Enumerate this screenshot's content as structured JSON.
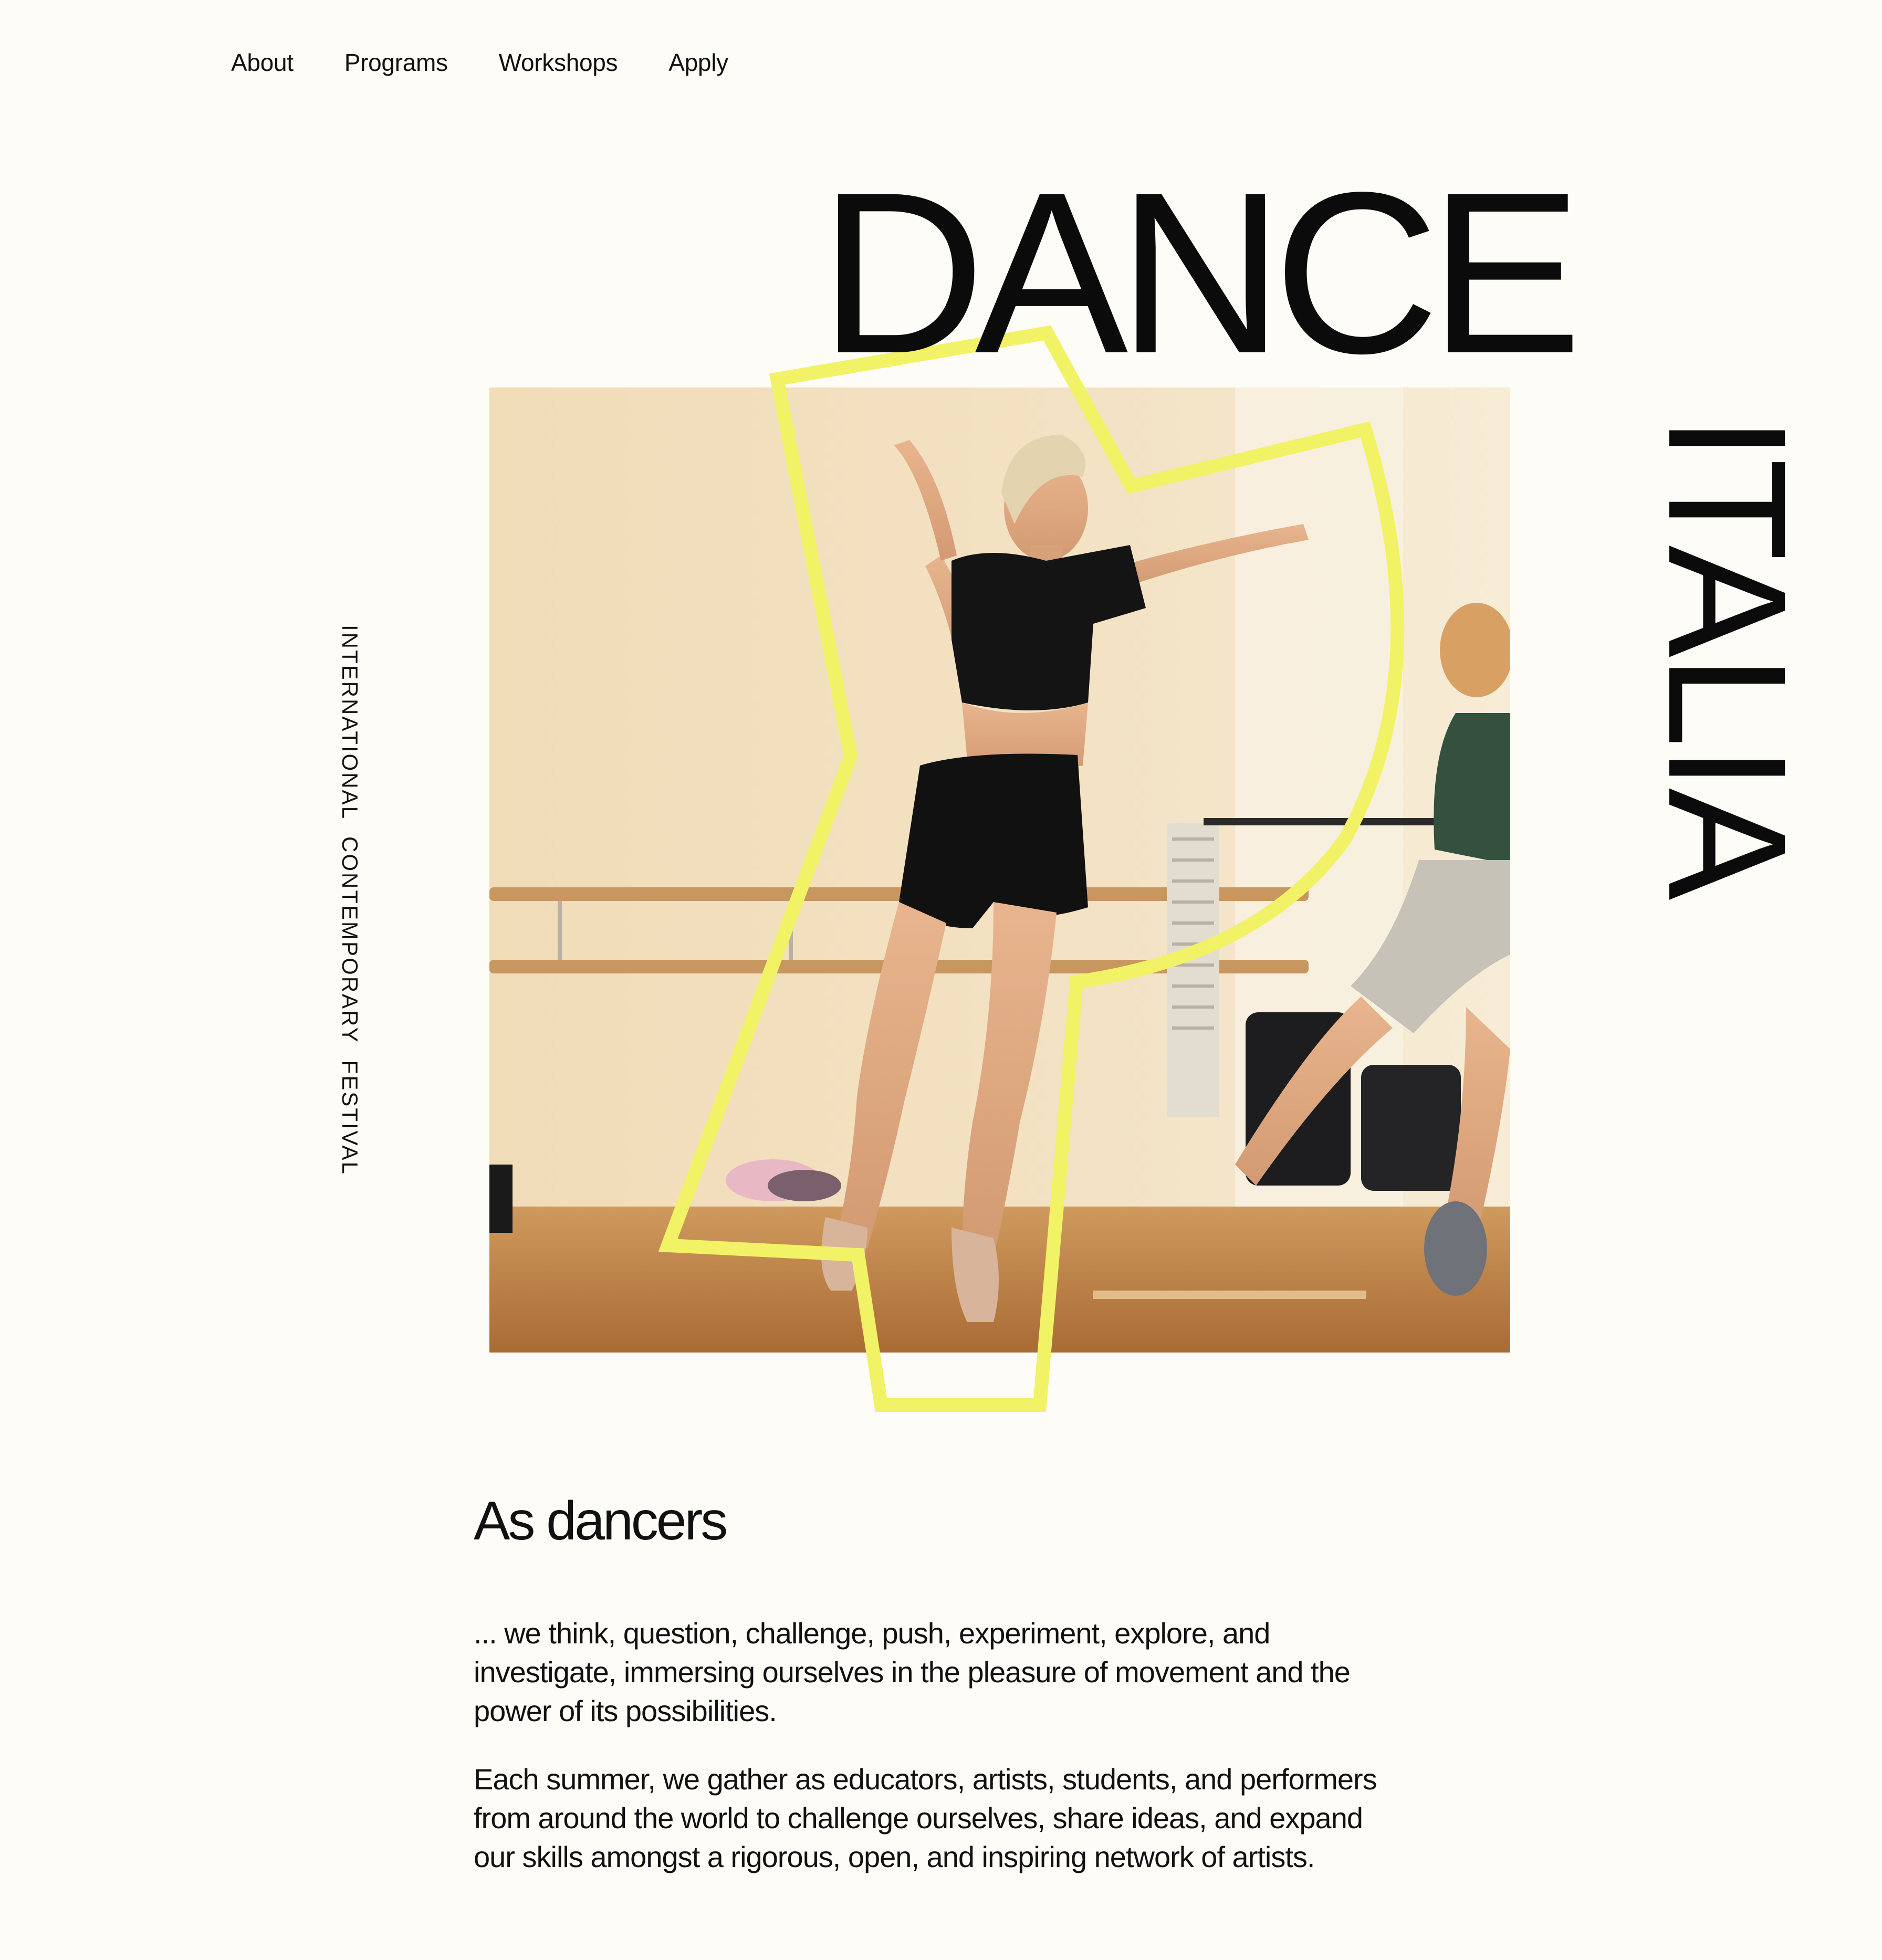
{
  "nav": {
    "items": [
      {
        "label": "About"
      },
      {
        "label": "Programs"
      },
      {
        "label": "Workshops"
      },
      {
        "label": "Apply"
      }
    ]
  },
  "hero": {
    "title_line1": "DANCE",
    "title_line2": "ITALIA",
    "caption": "INTERNATIONAL CONTEMPORARY FESTIVAL",
    "accent_color": "#F2F266"
  },
  "intro": {
    "heading": "As dancers",
    "paragraphs": [
      "... we think, question, challenge, push, experiment, explore, and investigate, immersing ourselves in the pleasure of movement and the power of its possibilities.",
      "Each summer, we gather as educators, artists, students, and performers from around the world to challenge ourselves, share ideas, and expand our skills amongst a rigorous, open, and inspiring network of artists."
    ]
  }
}
